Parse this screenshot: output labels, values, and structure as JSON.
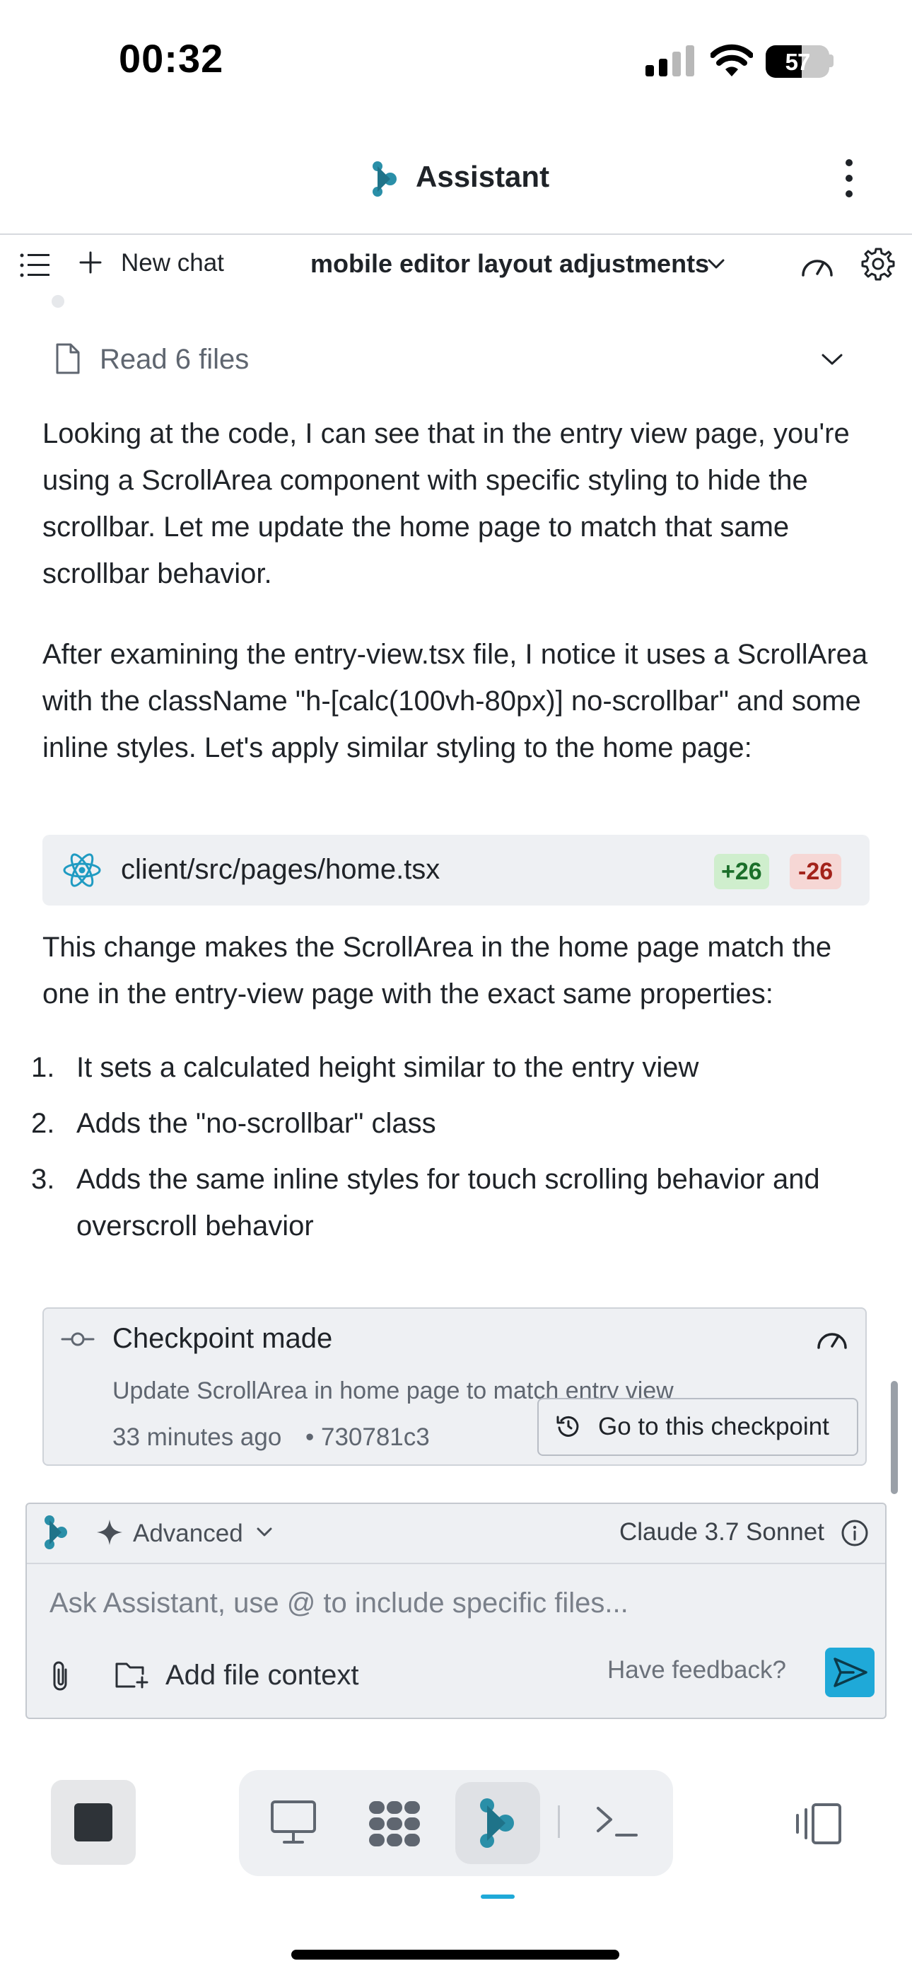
{
  "status_bar": {
    "time": "00:32",
    "battery": "57"
  },
  "header": {
    "title": "Assistant"
  },
  "toolbar": {
    "new_chat": "New chat",
    "chat_title": "mobile editor layout adjustments"
  },
  "conversation": {
    "read_files": "Read 6 files",
    "paragraph1": "Looking at the code, I can see that in the entry view page, you're using a ScrollArea component with specific styling to hide the scrollbar. Let me update the home page to match that same scrollbar behavior.",
    "paragraph2": "After examining the entry-view.tsx file, I notice it uses a ScrollArea with the className \"h-[calc(100vh-80px)] no-scrollbar\" and some inline styles. Let's apply similar styling to the home page:",
    "file_change": {
      "path": "client/src/pages/home.tsx",
      "added": "+26",
      "removed": "-26"
    },
    "paragraph3": "This change makes the ScrollArea in the home page match the one in the entry-view page with the exact same properties:",
    "list": [
      {
        "num": "1.",
        "text": "It sets a calculated height similar to the entry view"
      },
      {
        "num": "2.",
        "text": "Adds the \"no-scrollbar\" class"
      },
      {
        "num": "3.",
        "text": "Adds the same inline styles for touch scrolling behavior and overscroll behavior"
      }
    ]
  },
  "checkpoint": {
    "title": "Checkpoint made",
    "description": "Update ScrollArea in home page to match entry view",
    "time": "33 minutes ago",
    "hash": "• 730781c3",
    "button": "Go to this checkpoint"
  },
  "composer": {
    "mode": "Advanced",
    "model": "Claude 3.7 Sonnet",
    "placeholder": "Ask Assistant, use @ to include specific files...",
    "add_context": "Add file context",
    "feedback": "Have feedback?"
  },
  "icons": {
    "brand_color": "#2a8fa8",
    "accent_color": "#1fa9d8"
  }
}
